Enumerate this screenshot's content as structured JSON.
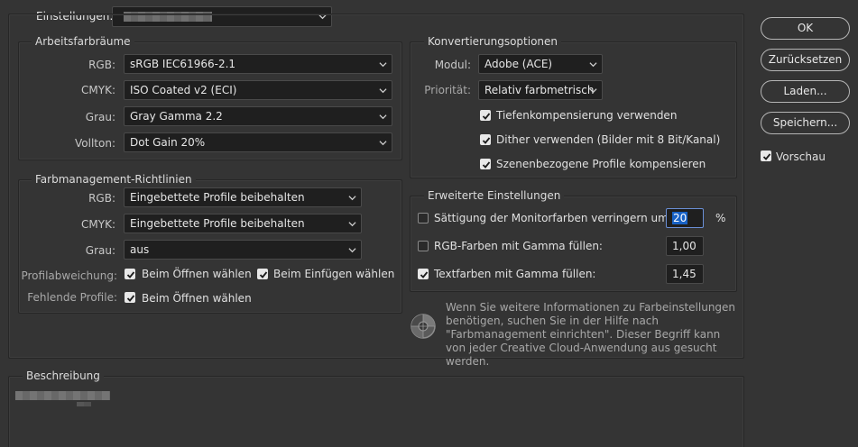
{
  "settings": {
    "label": "Einstellungen:"
  },
  "working_spaces": {
    "title": "Arbeitsfarbräume",
    "rows": [
      {
        "label": "RGB:",
        "value": "sRGB IEC61966-2.1"
      },
      {
        "label": "CMYK:",
        "value": "ISO Coated v2 (ECI)"
      },
      {
        "label": "Grau:",
        "value": "Gray Gamma 2.2"
      },
      {
        "label": "Vollton:",
        "value": "Dot Gain 20%"
      }
    ]
  },
  "policies": {
    "title": "Farbmanagement-Richtlinien",
    "rows": [
      {
        "label": "RGB:",
        "value": "Eingebettete Profile beibehalten"
      },
      {
        "label": "CMYK:",
        "value": "Eingebettete Profile beibehalten"
      },
      {
        "label": "Grau:",
        "value": "aus"
      }
    ],
    "mismatch_label": "Profilabweichung:",
    "mismatch_open": "Beim Öffnen wählen",
    "mismatch_paste": "Beim Einfügen wählen",
    "missing_label": "Fehlende Profile:",
    "missing_open": "Beim Öffnen wählen"
  },
  "conversion": {
    "title": "Konvertierungsoptionen",
    "engine_label": "Modul:",
    "engine_value": "Adobe (ACE)",
    "intent_label": "Priorität:",
    "intent_value": "Relativ farbmetrisch",
    "bpc": "Tiefenkompensierung verwenden",
    "dither": "Dither verwenden (Bilder mit 8 Bit/Kanal)",
    "scene": "Szenenbezogene Profile kompensieren"
  },
  "advanced": {
    "title": "Erweiterte Einstellungen",
    "desaturate": "Sättigung der Monitorfarben verringern um:",
    "desaturate_value": "20",
    "percent": "%",
    "blend_rgb": "RGB-Farben mit Gamma füllen:",
    "blend_rgb_value": "1,00",
    "blend_text": "Textfarben mit Gamma füllen:",
    "blend_text_value": "1,45"
  },
  "info_text": "Wenn Sie weitere Informationen zu Farbeinstellungen benötigen, suchen Sie in der Hilfe nach \"Farbmanagement einrichten\". Dieser Begriff kann von jeder Creative Cloud-Anwendung aus gesucht werden.",
  "description": {
    "title": "Beschreibung"
  },
  "buttons": {
    "ok": "OK",
    "reset": "Zurücksetzen",
    "load": "Laden...",
    "save": "Speichern...",
    "preview": "Vorschau"
  },
  "icons": {
    "dropdown": "chevron-down-icon",
    "check": "checkmark-icon",
    "info": "color-wheel-icon"
  },
  "colors": {
    "background": "#343434",
    "field": "#1f1f1f",
    "selection": "#1862c6"
  }
}
